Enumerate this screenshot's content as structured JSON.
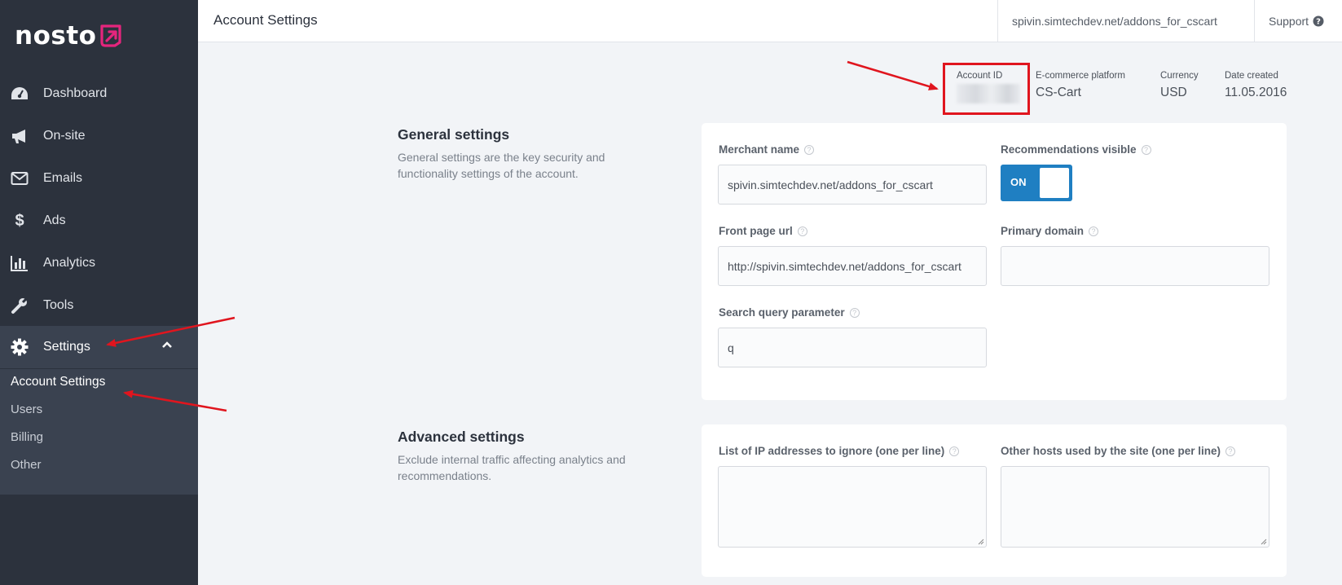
{
  "brand": {
    "name": "nosto",
    "accent": "#e5257d"
  },
  "sidebar": {
    "items": [
      {
        "label": "Dashboard",
        "icon": "dashboard-icon"
      },
      {
        "label": "On-site",
        "icon": "megaphone-icon"
      },
      {
        "label": "Emails",
        "icon": "envelope-icon"
      },
      {
        "label": "Ads",
        "icon": "dollar-icon"
      },
      {
        "label": "Analytics",
        "icon": "bar-chart-icon"
      },
      {
        "label": "Tools",
        "icon": "wrench-icon"
      },
      {
        "label": "Settings",
        "icon": "gear-icon"
      }
    ],
    "sub_items": [
      "Account Settings",
      "Users",
      "Billing",
      "Other"
    ]
  },
  "header": {
    "title": "Account Settings",
    "store_link": "spivin.simtechdev.net/addons_for_cscart",
    "support": "Support"
  },
  "account": {
    "id_label": "Account ID",
    "platform_label": "E-commerce platform",
    "platform_value": "CS-Cart",
    "currency_label": "Currency",
    "currency_value": "USD",
    "date_label": "Date created",
    "date_value": "11.05.2016"
  },
  "general": {
    "title": "General settings",
    "description": "General settings are the key security and functionality settings of the account.",
    "merchant_name_label": "Merchant name",
    "merchant_name_value": "spivin.simtechdev.net/addons_for_cscart",
    "recommendations_label": "Recommendations visible",
    "toggle_state": "ON",
    "front_page_label": "Front page url",
    "front_page_value": "http://spivin.simtechdev.net/addons_for_cscart",
    "primary_domain_label": "Primary domain",
    "primary_domain_value": "",
    "search_param_label": "Search query parameter",
    "search_param_value": "q"
  },
  "advanced": {
    "title": "Advanced settings",
    "description": "Exclude internal traffic affecting analytics and recommendations.",
    "ip_label": "List of IP addresses to ignore (one per line)",
    "hosts_label": "Other hosts used by the site (one per line)"
  },
  "colors": {
    "sidebar": "#2c323d",
    "toggle": "#1f7fc2",
    "annotation": "#e0151e"
  }
}
